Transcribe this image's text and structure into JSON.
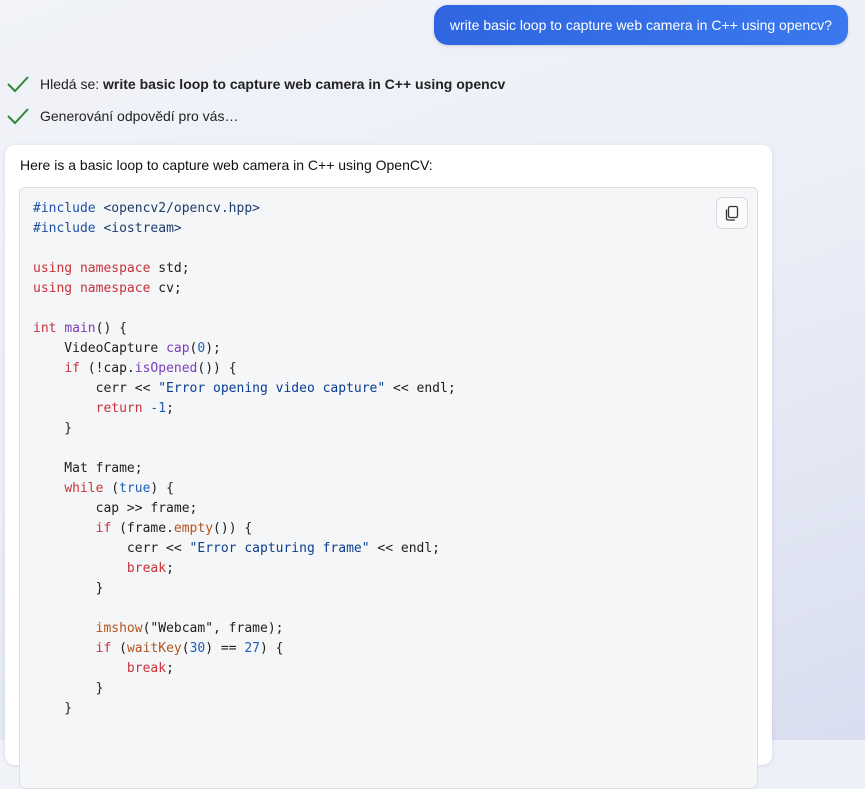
{
  "user_message": "write basic loop to capture web camera in C++ using opencv?",
  "status": {
    "searching_prefix": "Hledá se: ",
    "searching_query": "write basic loop to capture web camera in C++ using opencv",
    "generating": "Generování odpovědí pro vás…"
  },
  "response": {
    "intro": "Here is a basic loop to capture web camera in C++ using OpenCV:",
    "copy_icon": "copy-icon",
    "code_lines": [
      [
        {
          "t": "#include",
          "c": "pp"
        },
        {
          "t": " "
        },
        {
          "t": "<opencv2/opencv.hpp>",
          "c": "hdr"
        }
      ],
      [
        {
          "t": "#include",
          "c": "pp"
        },
        {
          "t": " "
        },
        {
          "t": "<iostream>",
          "c": "hdr"
        }
      ],
      [],
      [
        {
          "t": "using",
          "c": "kw"
        },
        {
          "t": " "
        },
        {
          "t": "namespace",
          "c": "kw"
        },
        {
          "t": " std;"
        }
      ],
      [
        {
          "t": "using",
          "c": "kw"
        },
        {
          "t": " "
        },
        {
          "t": "namespace",
          "c": "kw"
        },
        {
          "t": " cv;"
        }
      ],
      [],
      [
        {
          "t": "int",
          "c": "kw"
        },
        {
          "t": " "
        },
        {
          "t": "main",
          "c": "fn"
        },
        {
          "t": "() {"
        }
      ],
      [
        {
          "t": "    VideoCapture "
        },
        {
          "t": "cap",
          "c": "fn"
        },
        {
          "t": "("
        },
        {
          "t": "0",
          "c": "num"
        },
        {
          "t": ");"
        }
      ],
      [
        {
          "t": "    "
        },
        {
          "t": "if",
          "c": "kw"
        },
        {
          "t": " (!cap."
        },
        {
          "t": "isOpened",
          "c": "fn"
        },
        {
          "t": "()) {"
        }
      ],
      [
        {
          "t": "        cerr << "
        },
        {
          "t": "\"Error opening video capture\"",
          "c": "str"
        },
        {
          "t": " << endl;"
        }
      ],
      [
        {
          "t": "        "
        },
        {
          "t": "return",
          "c": "kw"
        },
        {
          "t": " "
        },
        {
          "t": "-1",
          "c": "num"
        },
        {
          "t": ";"
        }
      ],
      [
        {
          "t": "    }"
        }
      ],
      [],
      [
        {
          "t": "    Mat frame;"
        }
      ],
      [
        {
          "t": "    "
        },
        {
          "t": "while",
          "c": "kw"
        },
        {
          "t": " ("
        },
        {
          "t": "true",
          "c": "num"
        },
        {
          "t": ") {"
        }
      ],
      [
        {
          "t": "        cap >> frame;"
        }
      ],
      [
        {
          "t": "        "
        },
        {
          "t": "if",
          "c": "kw"
        },
        {
          "t": " (frame."
        },
        {
          "t": "empty",
          "c": "call"
        },
        {
          "t": "()) {"
        }
      ],
      [
        {
          "t": "            cerr << "
        },
        {
          "t": "\"Error capturing frame\"",
          "c": "str"
        },
        {
          "t": " << endl;"
        }
      ],
      [
        {
          "t": "            "
        },
        {
          "t": "break",
          "c": "kw"
        },
        {
          "t": ";"
        }
      ],
      [
        {
          "t": "        }"
        }
      ],
      [],
      [
        {
          "t": "        "
        },
        {
          "t": "imshow",
          "c": "call"
        },
        {
          "t": "(\"Webcam\", frame);"
        }
      ],
      [
        {
          "t": "        "
        },
        {
          "t": "if",
          "c": "kw"
        },
        {
          "t": " ("
        },
        {
          "t": "waitKey",
          "c": "call"
        },
        {
          "t": "("
        },
        {
          "t": "30",
          "c": "num"
        },
        {
          "t": ") == "
        },
        {
          "t": "27",
          "c": "num"
        },
        {
          "t": ") {"
        }
      ],
      [
        {
          "t": "            "
        },
        {
          "t": "break",
          "c": "kw"
        },
        {
          "t": ";"
        }
      ],
      [
        {
          "t": "        }"
        }
      ],
      [
        {
          "t": "    }"
        }
      ]
    ]
  },
  "colors": {
    "user_bubble": "#2f6fe5",
    "check": "#2b8a3e",
    "keyword": "#c8323a",
    "function": "#7a3db8",
    "number": "#1f5fb5"
  }
}
